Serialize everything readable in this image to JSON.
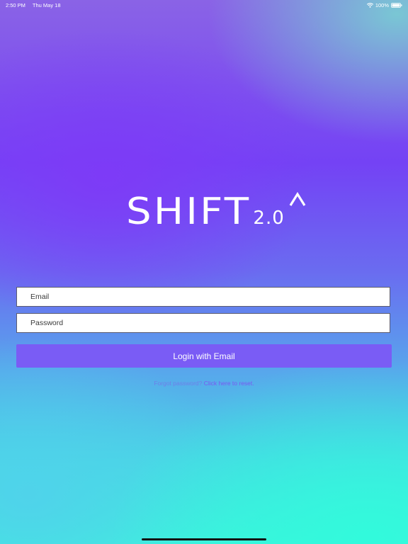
{
  "status_bar": {
    "time": "2:50 PM",
    "date": "Thu May 18",
    "battery": "100%",
    "wifi_icon": "wifi-icon",
    "battery_icon": "battery-full-icon"
  },
  "logo": {
    "main": "SHIFT",
    "version": "2.0",
    "caret_icon": "caret-up-icon"
  },
  "login": {
    "email_placeholder": "Email",
    "email_value": "",
    "password_placeholder": "Password",
    "password_value": "",
    "button_label": "Login with Email"
  },
  "forgot": {
    "question": "Forgot password?",
    "link": "Click here to reset."
  },
  "colors": {
    "button": "#7a5cf5",
    "link": "#7466f0",
    "gradient_top": "#7442f5",
    "gradient_bottom": "#3ef2dc"
  }
}
